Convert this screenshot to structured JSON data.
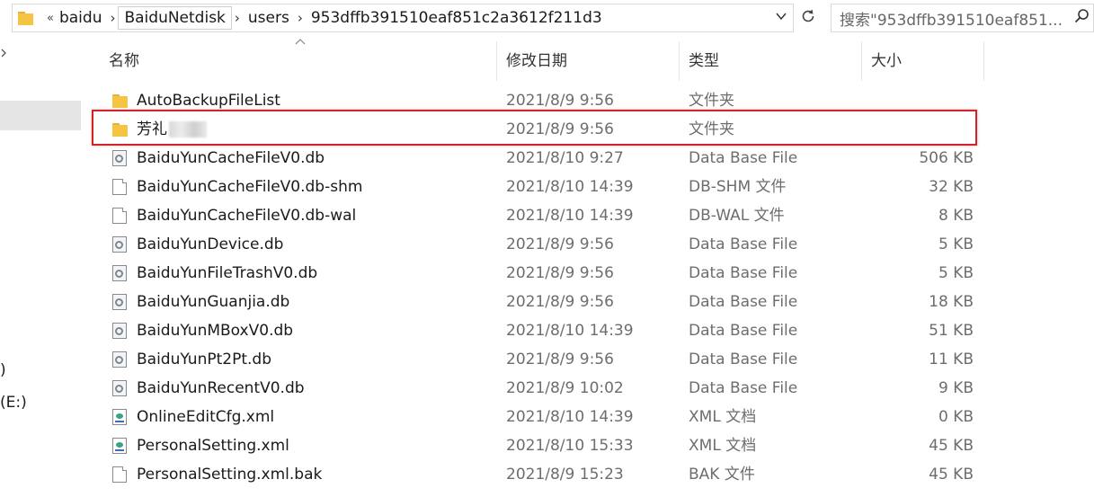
{
  "address_bar": {
    "overflow": "«",
    "breadcrumbs": [
      "baidu",
      "BaiduNetdisk",
      "users",
      "953dffb391510eaf851c2a3612f211d3"
    ],
    "separator": "›",
    "dropdown_icon": "chevron-down-icon",
    "refresh_icon": "refresh-icon"
  },
  "search": {
    "placeholder": "搜索\"953dffb391510eaf851...",
    "icon": "search-icon"
  },
  "nav_pane": {
    "fragments": [
      ")",
      "(E:)"
    ]
  },
  "columns": {
    "name": "名称",
    "date": "修改日期",
    "type": "类型",
    "size": "大小"
  },
  "files": [
    {
      "name": "AutoBackupFileList",
      "date": "2021/8/9 9:56",
      "type": "文件夹",
      "size": "",
      "icon": "folder-icon"
    },
    {
      "name": "芳礼",
      "date": "2021/8/9 9:56",
      "type": "文件夹",
      "size": "",
      "icon": "folder-icon",
      "blurred": true
    },
    {
      "name": "BaiduYunCacheFileV0.db",
      "date": "2021/8/10 9:27",
      "type": "Data Base File",
      "size": "506 KB",
      "icon": "database-file-icon"
    },
    {
      "name": "BaiduYunCacheFileV0.db-shm",
      "date": "2021/8/10 14:39",
      "type": "DB-SHM 文件",
      "size": "32 KB",
      "icon": "blank-file-icon"
    },
    {
      "name": "BaiduYunCacheFileV0.db-wal",
      "date": "2021/8/10 14:39",
      "type": "DB-WAL 文件",
      "size": "8 KB",
      "icon": "blank-file-icon"
    },
    {
      "name": "BaiduYunDevice.db",
      "date": "2021/8/9 9:56",
      "type": "Data Base File",
      "size": "5 KB",
      "icon": "database-file-icon"
    },
    {
      "name": "BaiduYunFileTrashV0.db",
      "date": "2021/8/9 9:56",
      "type": "Data Base File",
      "size": "5 KB",
      "icon": "database-file-icon"
    },
    {
      "name": "BaiduYunGuanjia.db",
      "date": "2021/8/9 9:56",
      "type": "Data Base File",
      "size": "18 KB",
      "icon": "database-file-icon"
    },
    {
      "name": "BaiduYunMBoxV0.db",
      "date": "2021/8/10 14:39",
      "type": "Data Base File",
      "size": "51 KB",
      "icon": "database-file-icon"
    },
    {
      "name": "BaiduYunPt2Pt.db",
      "date": "2021/8/9 9:56",
      "type": "Data Base File",
      "size": "11 KB",
      "icon": "database-file-icon"
    },
    {
      "name": "BaiduYunRecentV0.db",
      "date": "2021/8/9 10:02",
      "type": "Data Base File",
      "size": "9 KB",
      "icon": "database-file-icon"
    },
    {
      "name": "OnlineEditCfg.xml",
      "date": "2021/8/10 14:39",
      "type": "XML 文档",
      "size": "0 KB",
      "icon": "xml-file-icon"
    },
    {
      "name": "PersonalSetting.xml",
      "date": "2021/8/10 15:33",
      "type": "XML 文档",
      "size": "45 KB",
      "icon": "xml-file-icon"
    },
    {
      "name": "PersonalSetting.xml.bak",
      "date": "2021/8/9 15:23",
      "type": "BAK 文件",
      "size": "45 KB",
      "icon": "blank-file-icon"
    }
  ],
  "colors": {
    "highlight_border": "#d2232a",
    "folder": "#f5c542",
    "secondary_text": "#6d6d6d"
  }
}
